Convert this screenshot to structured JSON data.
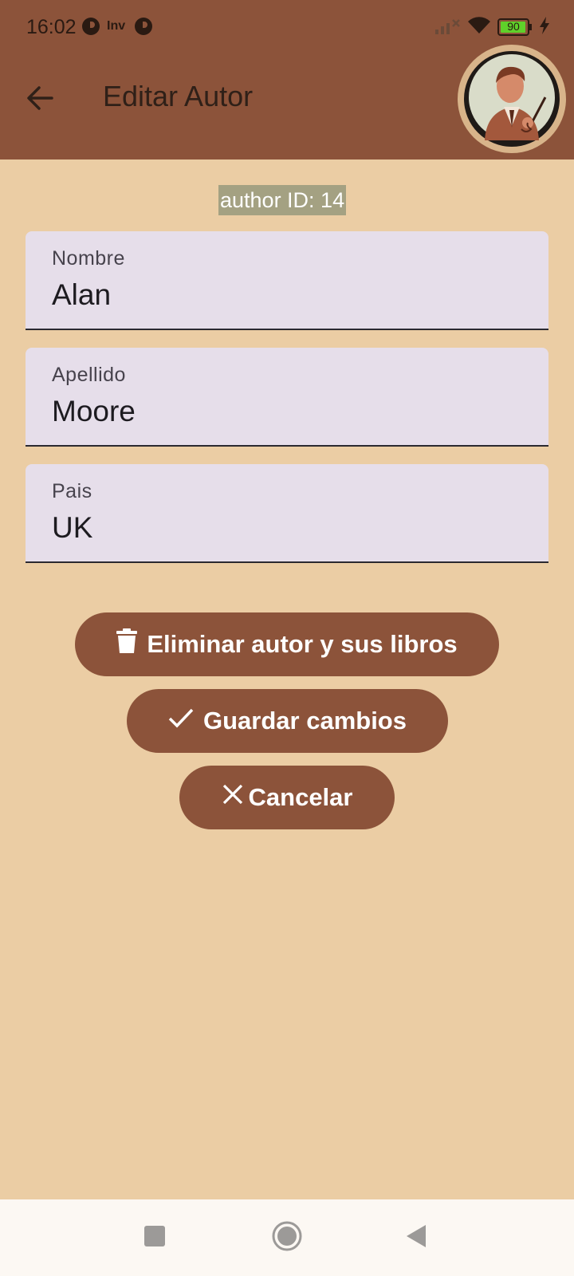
{
  "status_bar": {
    "time": "16:02",
    "battery": "90",
    "notification_icons": [
      "p-icon",
      "inv-icon",
      "p-icon"
    ],
    "inv_text": "Inv"
  },
  "app_bar": {
    "title": "Editar Autor",
    "background_color": "#8C533A",
    "back_icon": "arrow-left-icon",
    "avatar_icon": "author-portrait-icon"
  },
  "author_id_label": "author ID: 14",
  "form": {
    "fields": [
      {
        "label": "Nombre",
        "value": "Alan"
      },
      {
        "label": "Apellido",
        "value": "Moore"
      },
      {
        "label": "Pais",
        "value": "UK"
      }
    ]
  },
  "actions": {
    "delete_label": "Eliminar autor y sus libros",
    "save_label": "Guardar cambios",
    "cancel_label": "Cancelar",
    "button_color": "#8C533A"
  },
  "nav_bar": {
    "icons": [
      "square-icon",
      "circle-home-icon",
      "triangle-back-icon"
    ]
  },
  "colors": {
    "page_background": "#EBCDA4",
    "field_background": "#E6DEEA",
    "id_badge_background": "#A4A182"
  }
}
